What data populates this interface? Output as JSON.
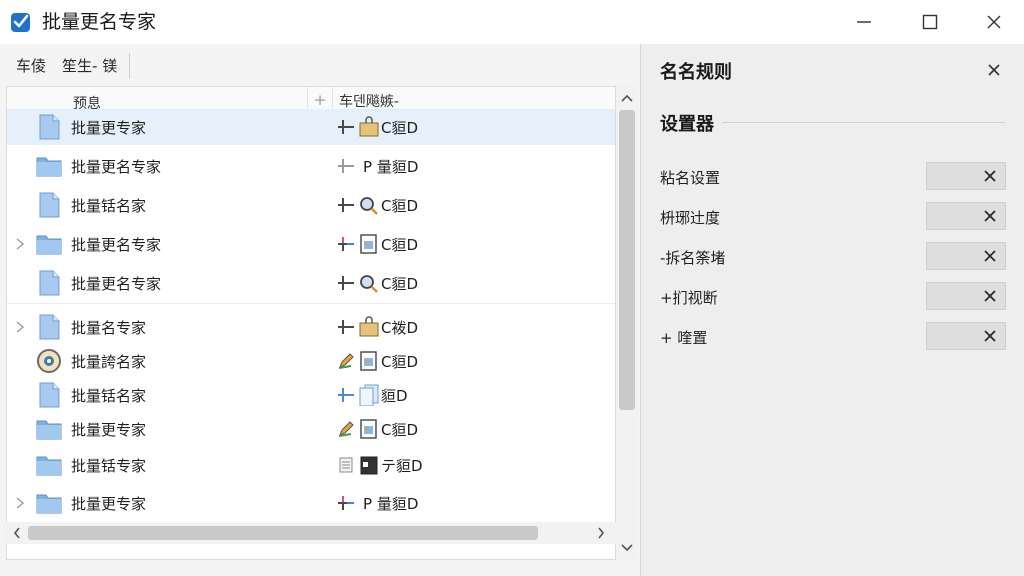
{
  "window": {
    "title": "批量更名专家"
  },
  "toolbar": {
    "buttons": [
      "车倰",
      "笙生- 镁"
    ]
  },
  "list": {
    "header": {
      "preview_label": "预息",
      "add_symbol": "+",
      "new_name_label": "车덴飚嫉-"
    },
    "rows": [
      {
        "icon": "document-icon",
        "name": "批量更专家",
        "new_name": "C貆D",
        "selected": true,
        "expander": false,
        "marker": "plus-arrow",
        "thumb": "folder-lock"
      },
      {
        "icon": "folder-icon",
        "name": "批量更名专家",
        "new_name": "P 量貆D",
        "selected": false,
        "expander": false,
        "marker": "plus-arrow-gray",
        "thumb": "none"
      },
      {
        "icon": "document-icon",
        "name": "批量铦名家",
        "new_name": "C貆D",
        "selected": false,
        "expander": false,
        "marker": "plus-arrow",
        "thumb": "magnifier"
      },
      {
        "icon": "folder-icon",
        "name": "批量更名专家",
        "new_name": "C貆D",
        "selected": false,
        "expander": true,
        "marker": "plus-arrow-color",
        "thumb": "image-doc"
      },
      {
        "icon": "document-icon",
        "name": "批量更名专家",
        "new_name": "C貆D",
        "selected": false,
        "expander": false,
        "marker": "plus-arrow",
        "thumb": "magnifier"
      },
      {
        "icon": "document-icon",
        "name": "批量名专家",
        "new_name": "C袯D",
        "selected": false,
        "expander": true,
        "marker": "plus-arrow",
        "thumb": "folder-lock"
      },
      {
        "icon": "compass-icon",
        "name": "批量誇名家",
        "new_name": "C貆D",
        "selected": false,
        "expander": false,
        "marker": "pencil",
        "thumb": "image-doc"
      },
      {
        "icon": "document-icon",
        "name": "批量铦名家",
        "new_name": "貆D",
        "selected": false,
        "expander": false,
        "marker": "plus-arrow-blue",
        "thumb": "pages"
      },
      {
        "icon": "folder-icon",
        "name": "批量更专家",
        "new_name": "C貆D",
        "selected": false,
        "expander": false,
        "marker": "pencil",
        "thumb": "image-doc"
      },
      {
        "icon": "folder-icon",
        "name": "批量铦专家",
        "new_name": "テ貆D",
        "selected": false,
        "expander": false,
        "marker": "doc-lines",
        "thumb": "calendar"
      },
      {
        "icon": "folder-icon",
        "name": "批量更专家",
        "new_name": "P 量貆D",
        "selected": false,
        "expander": true,
        "marker": "plus-arrow-color",
        "thumb": "none"
      }
    ]
  },
  "panel": {
    "title": "名名规则",
    "section_title": "设置器",
    "rules": [
      {
        "label": "粘名设置"
      },
      {
        "label": "枡琊辻度"
      },
      {
        "label": "-拆名筡堵"
      },
      {
        "label": "+扪视断"
      },
      {
        "label": "+ 喹置"
      }
    ]
  },
  "colors": {
    "accent": "#1e73c8",
    "folder": "#7fb0e0",
    "document": "#a9c9ee",
    "selection": "#e6f0fb"
  }
}
